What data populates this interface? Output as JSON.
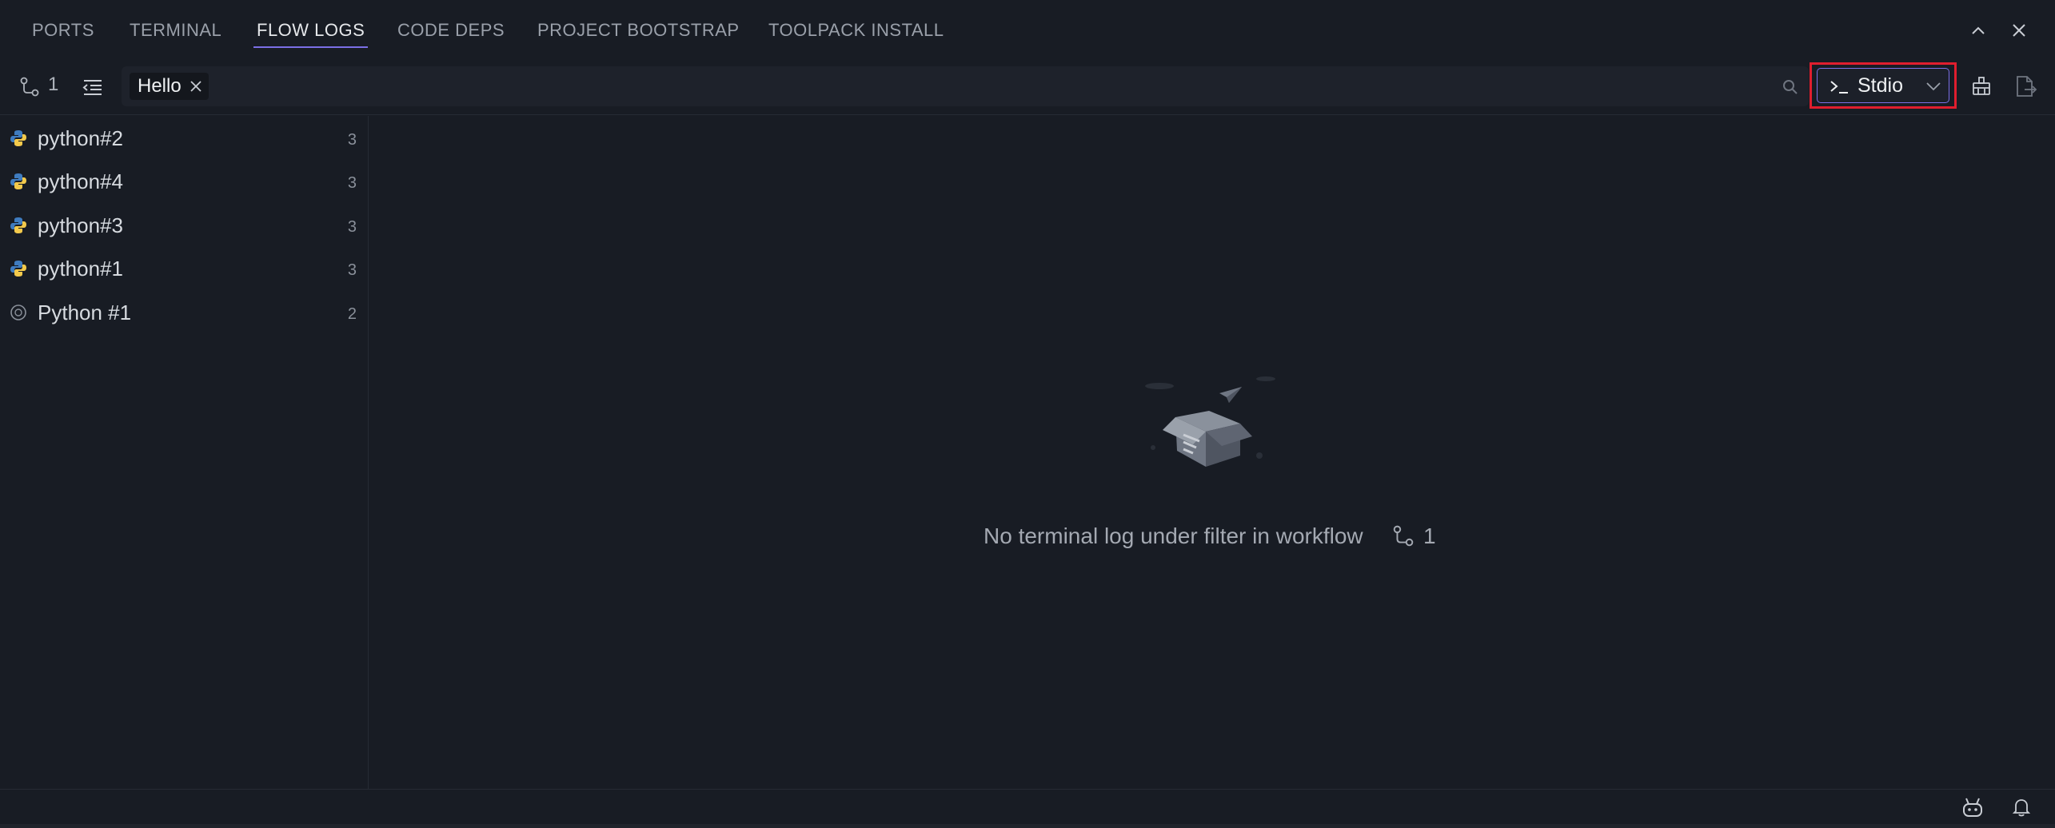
{
  "tabs": [
    {
      "label": "PORTS",
      "active": false
    },
    {
      "label": "TERMINAL",
      "active": false
    },
    {
      "label": "FLOW LOGS",
      "active": true
    },
    {
      "label": "CODE DEPS",
      "active": false
    },
    {
      "label": "PROJECT BOOTSTRAP",
      "active": false
    },
    {
      "label": "TOOLPACK INSTALL",
      "active": false
    }
  ],
  "window_controls": {
    "maximize_icon": "chevron-up-icon",
    "close_icon": "close-icon"
  },
  "toolbar": {
    "flow_icon": "workflow-icon",
    "flow_count": "1",
    "outline_icon": "outline-list-icon",
    "filter_chip": "Hello",
    "search_icon": "search-icon",
    "stream_select": {
      "prefix_icon": "terminal-prompt-icon",
      "value": "Stdio",
      "chevron_icon": "chevron-down-icon"
    },
    "clear_icon": "broom-icon",
    "export_icon": "export-file-icon"
  },
  "sidebar": {
    "items": [
      {
        "label": "python#2",
        "count": "3",
        "icon": "python-icon"
      },
      {
        "label": "python#4",
        "count": "3",
        "icon": "python-icon"
      },
      {
        "label": "python#3",
        "count": "3",
        "icon": "python-icon"
      },
      {
        "label": "python#1",
        "count": "3",
        "icon": "python-icon"
      },
      {
        "label": "Python #1",
        "count": "2",
        "icon": "info-circle-icon"
      }
    ]
  },
  "empty_state": {
    "message": "No terminal log under filter in workflow",
    "flow_icon": "workflow-icon",
    "flow_number": "1",
    "illustration": "open-box-icon"
  },
  "statusbar": {
    "bot_icon": "bot-icon",
    "bell_icon": "bell-icon"
  },
  "colors": {
    "background": "#181c24",
    "accent": "#7b6fe6",
    "highlight_outline": "#e01e2e",
    "python_blue": "#3f7cc0",
    "python_yellow": "#f2c94c"
  }
}
